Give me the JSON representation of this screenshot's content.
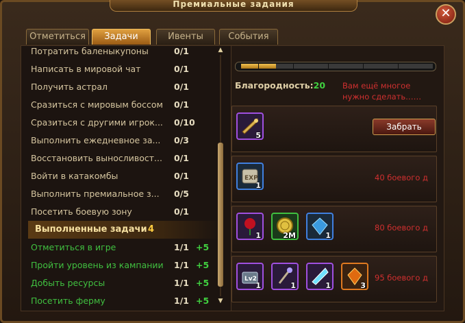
{
  "window": {
    "title": "Премиальные задания",
    "close_label": "✕"
  },
  "tabs": [
    {
      "label": "Отметиться"
    },
    {
      "label": "Задачи"
    },
    {
      "label": "Ивенты"
    },
    {
      "label": "События"
    }
  ],
  "active_tab": "Задачи",
  "tasks": [
    {
      "name": "Потратить баленыкупоны",
      "count": "0/1"
    },
    {
      "name": "Написать в мировой чат",
      "count": "0/1"
    },
    {
      "name": "Получить астрал",
      "count": "0/1"
    },
    {
      "name": "Сразиться с мировым боссом",
      "count": "0/1"
    },
    {
      "name": "Сразиться с другими игрок...",
      "count": "0/10"
    },
    {
      "name": "Выполнить ежедневное за...",
      "count": "0/3"
    },
    {
      "name": "Восстановить выносливост...",
      "count": "0/1"
    },
    {
      "name": "Войти в катакомбы",
      "count": "0/1"
    },
    {
      "name": "Выполнить премиальное з...",
      "count": "0/5"
    },
    {
      "name": "Посетить боевую зону",
      "count": "0/1"
    }
  ],
  "completed_section": {
    "label": "Выполненные задачи",
    "count": "4"
  },
  "completed_tasks": [
    {
      "name": "Отметиться в игре",
      "count": "1/1",
      "bonus": "+5"
    },
    {
      "name": "Пройти уровень из кампании",
      "count": "1/1",
      "bonus": "+5"
    },
    {
      "name": "Добыть ресурсы",
      "count": "1/1",
      "bonus": "+5"
    },
    {
      "name": "Посетить ферму",
      "count": "1/1",
      "bonus": "+5"
    }
  ],
  "progress": {
    "filled_segments": 2,
    "total_segments": 11
  },
  "honor": {
    "label": "Благородность:",
    "value": "20",
    "message": "Вам ещё многое нужно сделать……"
  },
  "rewards": [
    {
      "items": [
        {
          "icon": "horn-icon",
          "qty": "5",
          "border": "purple"
        }
      ],
      "claim_label": "Забрать",
      "requirement": ""
    },
    {
      "items": [
        {
          "icon": "exp-scroll-icon",
          "qty": "1",
          "border": "blue"
        }
      ],
      "claim_label": "",
      "requirement": "40 боевого д"
    },
    {
      "items": [
        {
          "icon": "rose-icon",
          "qty": "1",
          "border": "purple"
        },
        {
          "icon": "gold-coin-icon",
          "qty": "2M",
          "border": "green"
        },
        {
          "icon": "blue-crystal-icon",
          "qty": "1",
          "border": "blue"
        }
      ],
      "claim_label": "",
      "requirement": "80 боевого д"
    },
    {
      "items": [
        {
          "icon": "lv2-chest-icon",
          "qty": "1",
          "border": "purple"
        },
        {
          "icon": "magic-staff-icon",
          "qty": "1",
          "border": "purple"
        },
        {
          "icon": "prism-shard-icon",
          "qty": "1",
          "border": "purple"
        },
        {
          "icon": "fire-gem-icon",
          "qty": "3",
          "border": "orange"
        }
      ],
      "claim_label": "",
      "requirement": "95 боевого д"
    }
  ],
  "colors": {
    "accent": "#e0a040",
    "completed": "#40c040",
    "warning": "#d03030"
  }
}
